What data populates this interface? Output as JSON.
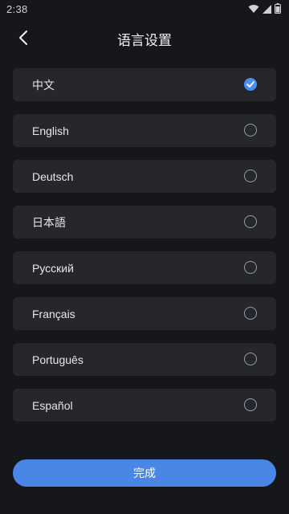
{
  "status_bar": {
    "time": "2:38",
    "icons": [
      "wifi-icon",
      "signal-icon",
      "battery-icon"
    ]
  },
  "header": {
    "title": "语言设置",
    "back_icon": "chevron-left-icon"
  },
  "languages": [
    {
      "label": "中文",
      "selected": true
    },
    {
      "label": "English",
      "selected": false
    },
    {
      "label": "Deutsch",
      "selected": false
    },
    {
      "label": "日本語",
      "selected": false
    },
    {
      "label": "Русский",
      "selected": false
    },
    {
      "label": "Français",
      "selected": false
    },
    {
      "label": "Português",
      "selected": false
    },
    {
      "label": "Español",
      "selected": false
    }
  ],
  "done_button": {
    "label": "完成"
  },
  "colors": {
    "background": "#16171b",
    "item_background": "#26272d",
    "accent": "#4a8ef5",
    "button": "#4a86e6"
  }
}
